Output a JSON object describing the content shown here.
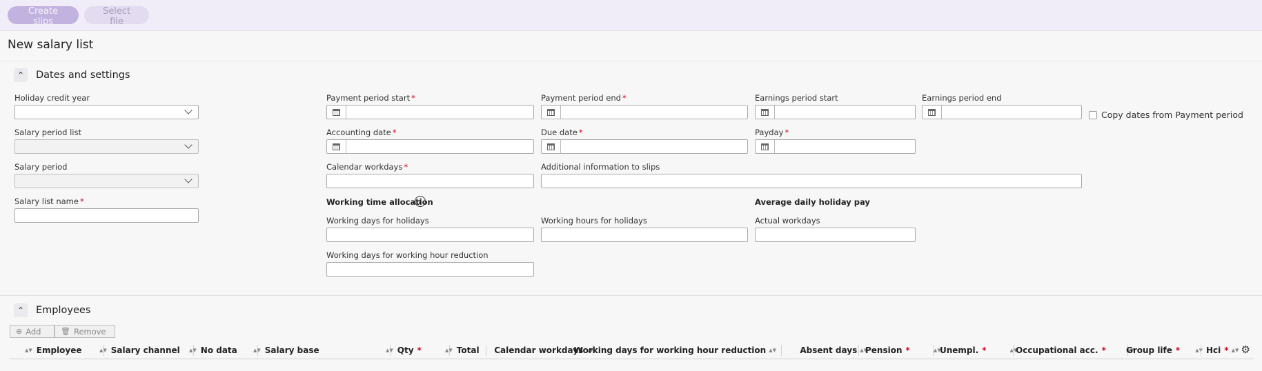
{
  "toolbar": {
    "create_slips": "Create slips",
    "select_file": "Select file"
  },
  "page_title": "New salary list",
  "dates_section": {
    "title": "Dates and settings",
    "holiday_credit_year": "Holiday credit year",
    "salary_period_list": "Salary period list",
    "salary_period": "Salary period",
    "salary_list_name": "Salary list name",
    "payment_period_start": "Payment period start",
    "payment_period_end": "Payment period end",
    "earnings_period_start": "Earnings period start",
    "earnings_period_end": "Earnings period end",
    "copy_dates": "Copy dates from Payment period",
    "accounting_date": "Accounting date",
    "due_date": "Due date",
    "payday": "Payday",
    "calendar_workdays": "Calendar workdays",
    "additional_info": "Additional information to slips",
    "working_time_allocation": "Working time allocation",
    "average_daily_holiday_pay": "Average daily holiday pay",
    "working_days_holidays": "Working days for holidays",
    "working_hours_holidays": "Working hours for holidays",
    "actual_workdays": "Actual workdays",
    "working_days_reduction": "Working days for working hour reduction",
    "required_mark": "*",
    "info_glyph": "i"
  },
  "employees_section": {
    "title": "Employees",
    "add": "Add",
    "remove": "Remove",
    "columns": [
      {
        "label": "Employee",
        "required": false
      },
      {
        "label": "Salary channel",
        "required": false
      },
      {
        "label": "No data",
        "required": false
      },
      {
        "label": "Salary base",
        "required": false
      },
      {
        "label": "Qty",
        "required": true
      },
      {
        "label": "Total",
        "required": false
      },
      {
        "label": "Calendar workdays",
        "required": false
      },
      {
        "label": "Working days for working hour reduction",
        "required": false
      },
      {
        "label": "Absent days",
        "required": false
      },
      {
        "label": "Pension",
        "required": true
      },
      {
        "label": "Unempl.",
        "required": true
      },
      {
        "label": "Occupational acc.",
        "required": true
      },
      {
        "label": "Group life",
        "required": true
      },
      {
        "label": "Hci",
        "required": true
      }
    ]
  },
  "icons": {
    "collapse": "chevron-up-icon",
    "calendar": "calendar-icon",
    "info": "info-icon",
    "add": "plus-circle-icon",
    "remove": "trash-icon",
    "settings": "gear-icon",
    "sort": "sort-icon"
  },
  "colors": {
    "primary_button": "#c2b2df",
    "toolbar_bg": "#f1edf8",
    "required": "#d0021b"
  }
}
